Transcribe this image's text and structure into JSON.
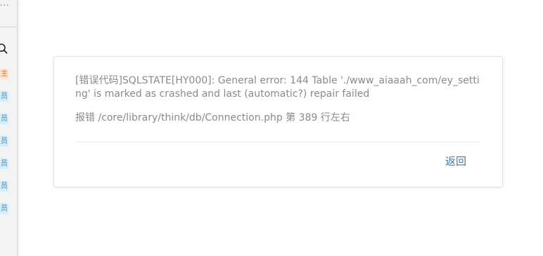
{
  "sidebar": {
    "menu_dots": "...",
    "search_icon": "search-icon",
    "tags": [
      {
        "label": "主",
        "kind": "owner",
        "color": "#e0762f"
      },
      {
        "label": "员",
        "kind": "member",
        "color": "#2f8fd6"
      },
      {
        "label": "员",
        "kind": "member",
        "color": "#2f8fd6"
      },
      {
        "label": "员",
        "kind": "member",
        "color": "#2f8fd6"
      },
      {
        "label": "员",
        "kind": "member",
        "color": "#2f8fd6"
      },
      {
        "label": "员",
        "kind": "member",
        "color": "#2f8fd6"
      },
      {
        "label": "员",
        "kind": "member",
        "color": "#2f8fd6"
      }
    ]
  },
  "dialog": {
    "error_message": "[错误代码]SQLSTATE[HY000]: General error: 144 Table './www_aiaaah_com/ey_setting' is marked as crashed and last (automatic?) repair failed",
    "error_location": "报错 /core/library/think/db/Connection.php 第 389 行左右",
    "back_label": "返回",
    "link_color": "#3a7ab8"
  }
}
